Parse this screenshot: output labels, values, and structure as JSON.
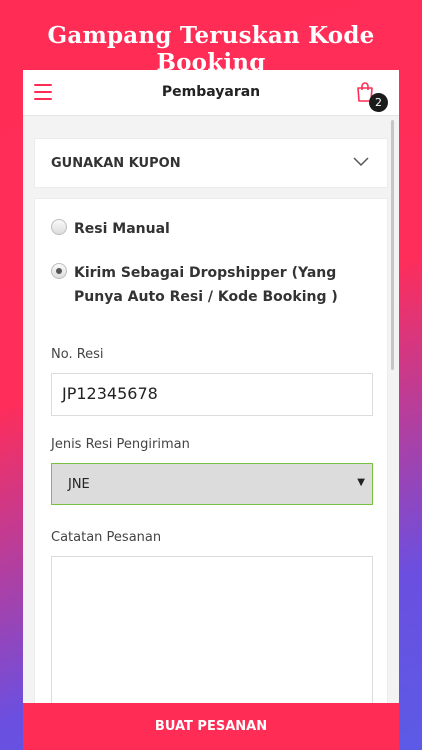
{
  "promo": {
    "title": "Gampang Teruskan Kode Booking"
  },
  "appbar": {
    "title": "Pembayaran",
    "cart_count": "2"
  },
  "coupon": {
    "label": "GUNAKAN KUPON"
  },
  "shipping_options": [
    {
      "label": "Resi Manual",
      "selected": false
    },
    {
      "label": "Kirim Sebagai Dropshipper (Yang Punya Auto Resi / Kode Booking )",
      "selected": true
    }
  ],
  "form": {
    "resi_label": "No. Resi",
    "resi_value": "JP12345678",
    "jenis_label": "Jenis Resi Pengiriman",
    "jenis_value": "JNE",
    "catatan_label": "Catatan Pesanan",
    "catatan_value": ""
  },
  "footer": {
    "order_button": "BUAT PESANAN"
  },
  "colors": {
    "accent": "#ff2d55",
    "select_border": "#7ac143"
  },
  "icons": [
    "menu-icon",
    "shopping-bag-icon",
    "chevron-down-icon"
  ]
}
